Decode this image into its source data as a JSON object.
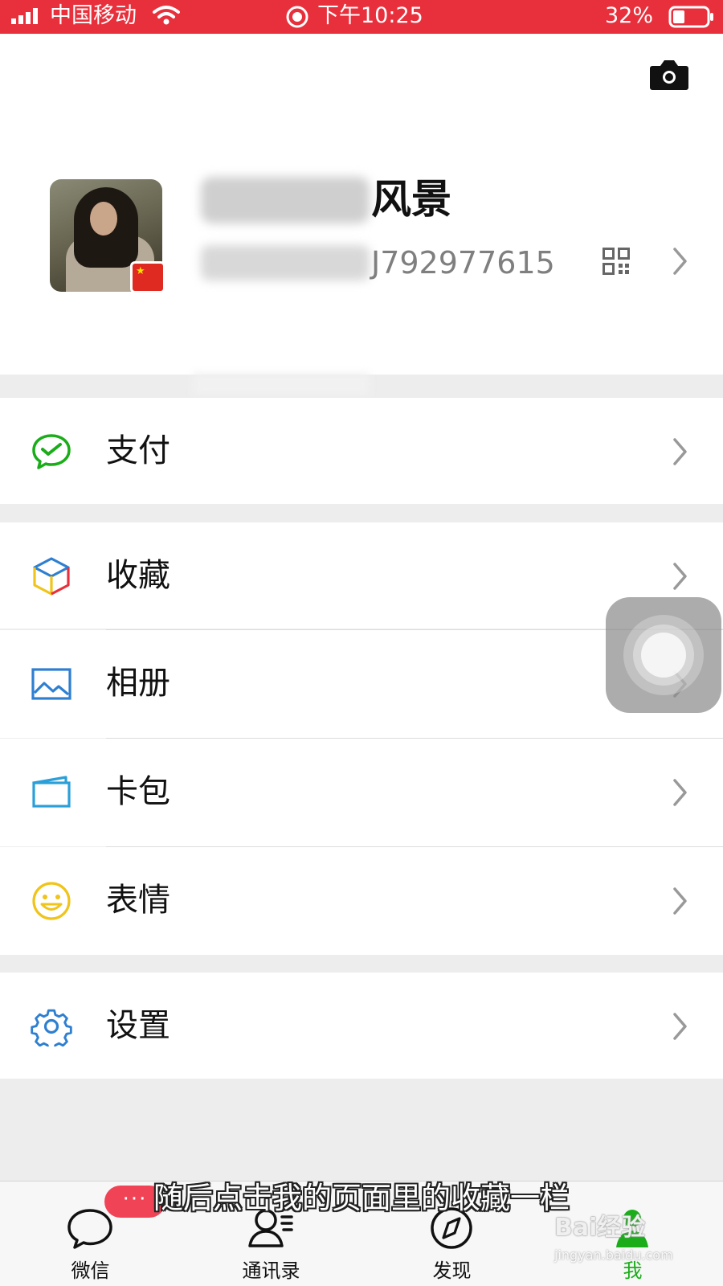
{
  "status_bar": {
    "carrier": "中国移动",
    "time": "下午10:25",
    "battery": "32%"
  },
  "profile": {
    "nickname": "风景",
    "wechat_id": "J792977615",
    "avatar_badge": "china-flag"
  },
  "menu": {
    "pay": "支付",
    "favorites": "收藏",
    "album": "相册",
    "cards": "卡包",
    "stickers": "表情",
    "settings": "设置"
  },
  "tabbar": {
    "chats": "微信",
    "contacts": "通讯录",
    "discover": "发现",
    "me": "我",
    "chats_badge": "···",
    "active": "me"
  },
  "overlay": {
    "subtitle": "随后点击我的页面里的收藏一栏",
    "watermark": "Bai经验",
    "watermark_url": "jingyan.baidu.com"
  },
  "colors": {
    "status_bar": "#e8303c",
    "accent_green": "#1aad19",
    "badge": "#f04356",
    "pay_icon": "#1aad19",
    "album_icon": "#2f7fd1",
    "cards_icon": "#2b9fd8",
    "stickers_icon": "#f0c419",
    "settings_icon": "#2f7fd1"
  }
}
